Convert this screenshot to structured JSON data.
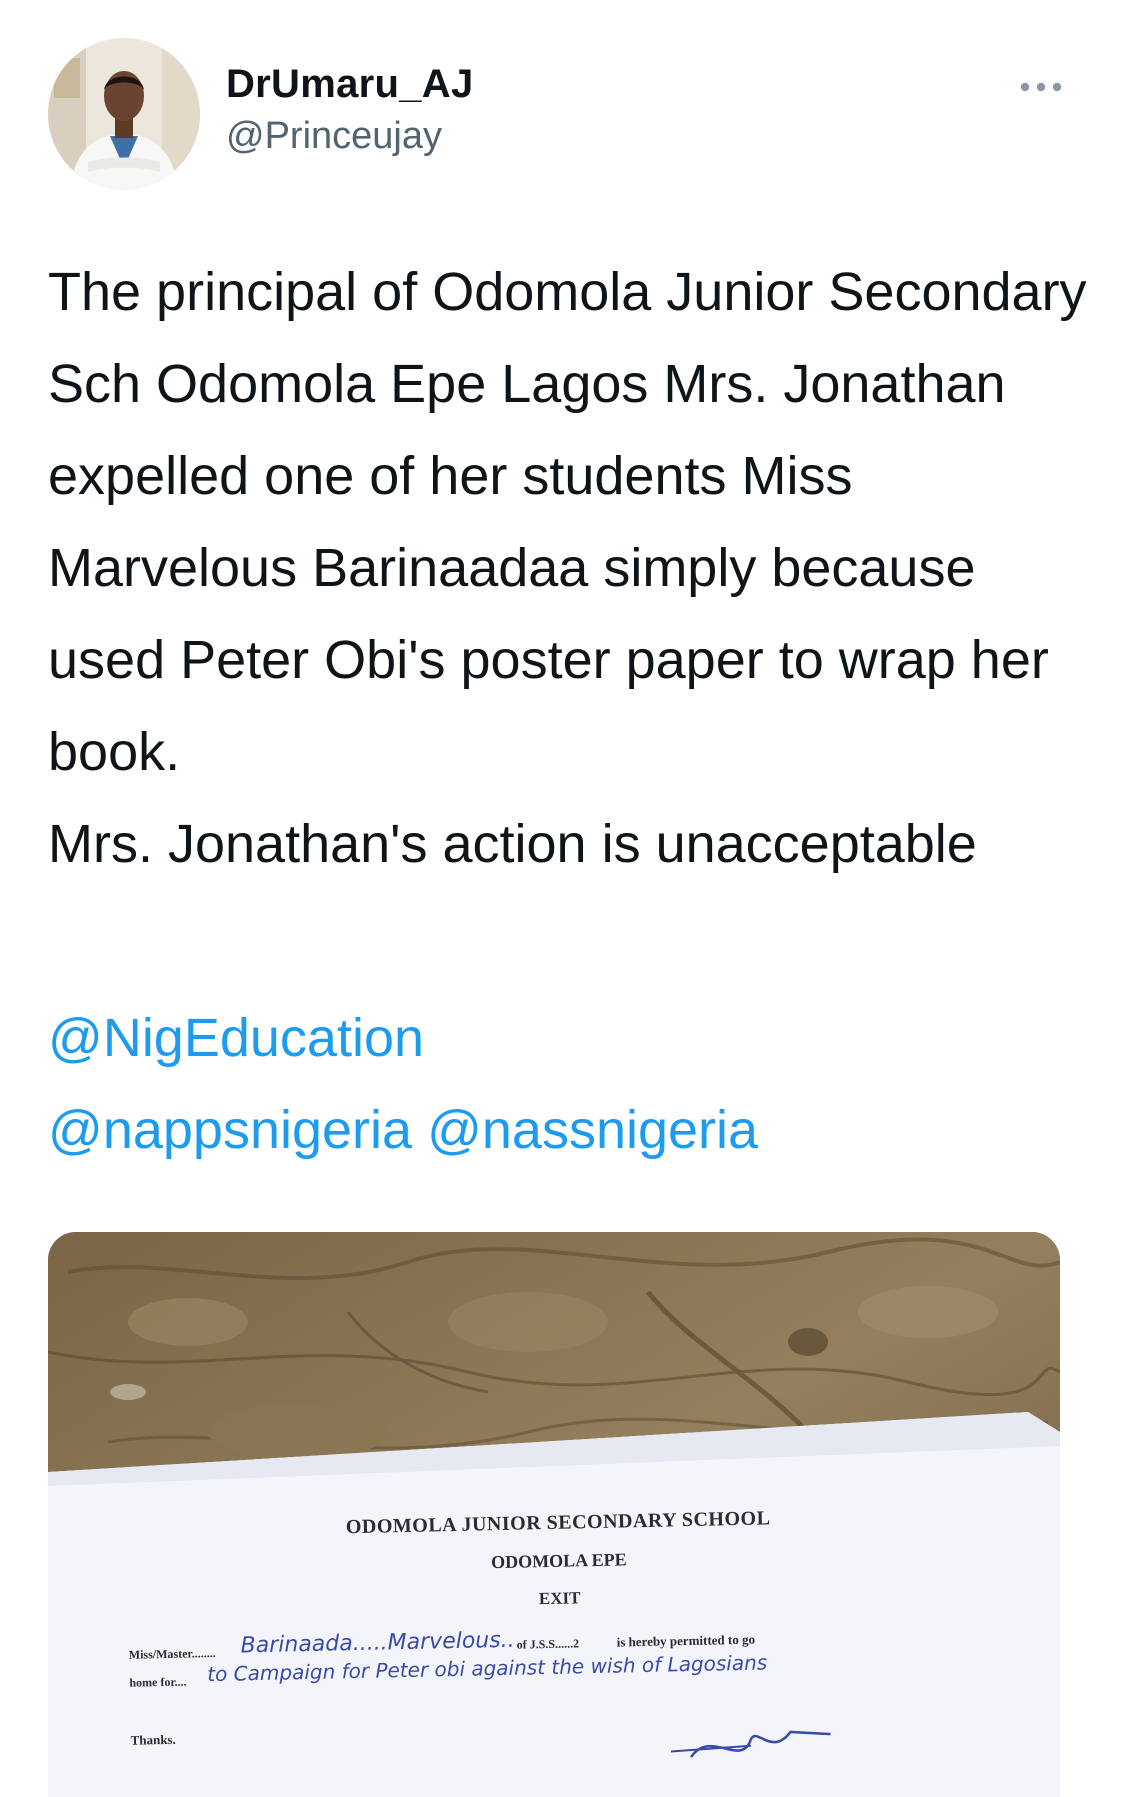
{
  "tweet": {
    "author": {
      "display_name": "DrUmaru_AJ",
      "handle": "@Princeujay"
    },
    "more_icon": "more-horizontal-icon",
    "text": "The principal of Odomola Junior Secondary Sch Odomola Epe Lagos Mrs. Jonathan expelled one of her students Miss Marvelous Barinaadaa simply because used Peter Obi's poster paper to wrap her book.\n  Mrs. Jonathan's action is unacceptable",
    "mentions": [
      "@NigEducation",
      "@nappsnigeria",
      "@nassnigeria"
    ],
    "link_color": "#1d9bf0"
  },
  "photo": {
    "school_name": "ODOMOLA JUNIOR SECONDARY SCHOOL",
    "school_location": "ODOMOLA EPE",
    "document_title": "EXIT",
    "line1_prefix": "Miss/Master........",
    "line1_name": "Barinaada.....Marvelous..",
    "line1_class": "of J.S.S......2",
    "line1_suffix": "is hereby permitted to go",
    "line2_prefix": "home for....",
    "line2_reason": "to Campaign for Peter obi against the wish of Lagosians",
    "closing": "Thanks."
  }
}
